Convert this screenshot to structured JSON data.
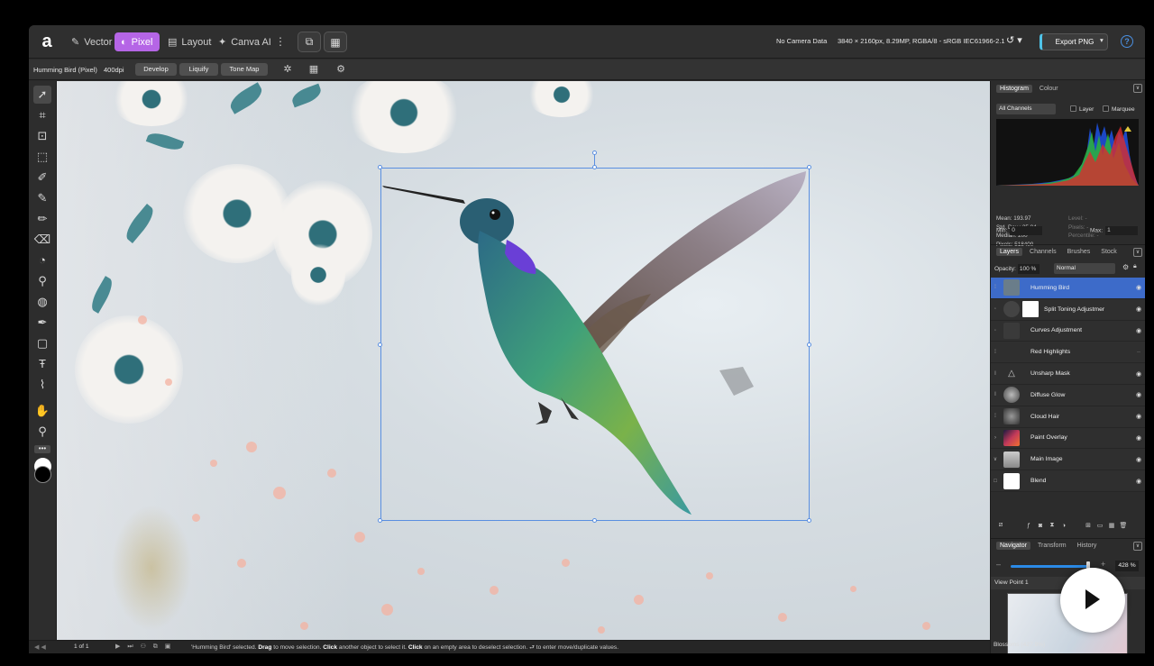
{
  "topbar": {
    "logo": "a",
    "personas": [
      {
        "label": "Vector",
        "icon": "✎"
      },
      {
        "label": "Pixel",
        "icon": "◐"
      },
      {
        "label": "Layout",
        "icon": "▤"
      },
      {
        "label": "Canva AI",
        "icon": "✦"
      }
    ],
    "camera": "No Camera Data",
    "doc_info": "3840 × 2160px, 8.29MP, RGBA/8 - sRGB IEC61966-2.1",
    "export_label": "Export PNG",
    "help": "?"
  },
  "context": {
    "layer_name": "Humming Bird (Pixel)",
    "dpi": "400dpi",
    "buttons": [
      "Develop",
      "Liquify",
      "Tone Map"
    ]
  },
  "histogram": {
    "tabs": [
      "Histogram",
      "Colour"
    ],
    "channel": "All Channels",
    "layer_label": "Layer",
    "marquee_label": "Marquee",
    "mean": "Mean: 193.97",
    "std": "Std. Dev.: 35.84",
    "median": "Median: 200",
    "pixels": "Pixels: 518400",
    "level": "Level: -",
    "pixels2": "Pixels: -",
    "percentile": "Percentile: -",
    "min_label": "Min:",
    "min_val": "0",
    "max_label": "Max:",
    "max_val": "1"
  },
  "layers_panel": {
    "tabs": [
      "Layers",
      "Channels",
      "Brushes",
      "Stock"
    ],
    "opacity_label": "Opacity:",
    "opacity_val": "100 %",
    "blend_mode": "Normal",
    "layers": [
      "Humming Bird",
      "Split Toning Adjustmer",
      "Curves Adjustment",
      "Red Highlights",
      "Unsharp Mask",
      "Diffuse Glow",
      "Cloud Hair",
      "Paint Overlay",
      "Main Image",
      "Blend"
    ]
  },
  "navigator": {
    "tabs": [
      "Navigator",
      "Transform",
      "History"
    ],
    "zoom": "428 %",
    "zoom_level": 0.92,
    "view_point": "View Point 1"
  },
  "status": {
    "page": "1 of 1",
    "pre": "'Humming Bird' selected.",
    "drag": "Drag",
    "t1": "to move selection.",
    "click1": "Click",
    "t2": "another object to select it.",
    "click2": "Click",
    "t3": "on an empty area to deselect selection. ⮐ to enter move/duplicate values.",
    "doc_zoom": "Blossoms (427.9%)"
  },
  "colors": {
    "accent": "#b565e6",
    "selection": "#3d6bc9",
    "handle": "#5a8fe0"
  }
}
